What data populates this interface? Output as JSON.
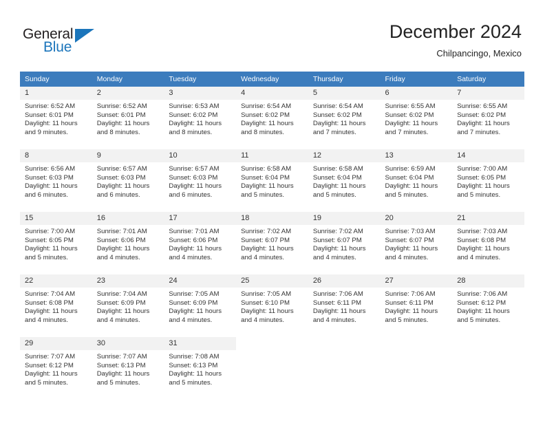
{
  "logo": {
    "word1": "General",
    "word2": "Blue",
    "triangle_icon": "triangle-icon",
    "color_blue": "#1b75bb",
    "color_dark": "#231f20"
  },
  "header": {
    "title": "December 2024",
    "subtitle": "Chilpancingo, Mexico"
  },
  "calendar": {
    "header_bg": "#3c7cbd",
    "daynum_bg": "#f2f2f2",
    "weekdays": [
      "Sunday",
      "Monday",
      "Tuesday",
      "Wednesday",
      "Thursday",
      "Friday",
      "Saturday"
    ],
    "weeks": [
      [
        {
          "day": "1",
          "sunrise": "Sunrise: 6:52 AM",
          "sunset": "Sunset: 6:01 PM",
          "daylight1": "Daylight: 11 hours",
          "daylight2": "and 9 minutes."
        },
        {
          "day": "2",
          "sunrise": "Sunrise: 6:52 AM",
          "sunset": "Sunset: 6:01 PM",
          "daylight1": "Daylight: 11 hours",
          "daylight2": "and 8 minutes."
        },
        {
          "day": "3",
          "sunrise": "Sunrise: 6:53 AM",
          "sunset": "Sunset: 6:02 PM",
          "daylight1": "Daylight: 11 hours",
          "daylight2": "and 8 minutes."
        },
        {
          "day": "4",
          "sunrise": "Sunrise: 6:54 AM",
          "sunset": "Sunset: 6:02 PM",
          "daylight1": "Daylight: 11 hours",
          "daylight2": "and 8 minutes."
        },
        {
          "day": "5",
          "sunrise": "Sunrise: 6:54 AM",
          "sunset": "Sunset: 6:02 PM",
          "daylight1": "Daylight: 11 hours",
          "daylight2": "and 7 minutes."
        },
        {
          "day": "6",
          "sunrise": "Sunrise: 6:55 AM",
          "sunset": "Sunset: 6:02 PM",
          "daylight1": "Daylight: 11 hours",
          "daylight2": "and 7 minutes."
        },
        {
          "day": "7",
          "sunrise": "Sunrise: 6:55 AM",
          "sunset": "Sunset: 6:02 PM",
          "daylight1": "Daylight: 11 hours",
          "daylight2": "and 7 minutes."
        }
      ],
      [
        {
          "day": "8",
          "sunrise": "Sunrise: 6:56 AM",
          "sunset": "Sunset: 6:03 PM",
          "daylight1": "Daylight: 11 hours",
          "daylight2": "and 6 minutes."
        },
        {
          "day": "9",
          "sunrise": "Sunrise: 6:57 AM",
          "sunset": "Sunset: 6:03 PM",
          "daylight1": "Daylight: 11 hours",
          "daylight2": "and 6 minutes."
        },
        {
          "day": "10",
          "sunrise": "Sunrise: 6:57 AM",
          "sunset": "Sunset: 6:03 PM",
          "daylight1": "Daylight: 11 hours",
          "daylight2": "and 6 minutes."
        },
        {
          "day": "11",
          "sunrise": "Sunrise: 6:58 AM",
          "sunset": "Sunset: 6:04 PM",
          "daylight1": "Daylight: 11 hours",
          "daylight2": "and 5 minutes."
        },
        {
          "day": "12",
          "sunrise": "Sunrise: 6:58 AM",
          "sunset": "Sunset: 6:04 PM",
          "daylight1": "Daylight: 11 hours",
          "daylight2": "and 5 minutes."
        },
        {
          "day": "13",
          "sunrise": "Sunrise: 6:59 AM",
          "sunset": "Sunset: 6:04 PM",
          "daylight1": "Daylight: 11 hours",
          "daylight2": "and 5 minutes."
        },
        {
          "day": "14",
          "sunrise": "Sunrise: 7:00 AM",
          "sunset": "Sunset: 6:05 PM",
          "daylight1": "Daylight: 11 hours",
          "daylight2": "and 5 minutes."
        }
      ],
      [
        {
          "day": "15",
          "sunrise": "Sunrise: 7:00 AM",
          "sunset": "Sunset: 6:05 PM",
          "daylight1": "Daylight: 11 hours",
          "daylight2": "and 5 minutes."
        },
        {
          "day": "16",
          "sunrise": "Sunrise: 7:01 AM",
          "sunset": "Sunset: 6:06 PM",
          "daylight1": "Daylight: 11 hours",
          "daylight2": "and 4 minutes."
        },
        {
          "day": "17",
          "sunrise": "Sunrise: 7:01 AM",
          "sunset": "Sunset: 6:06 PM",
          "daylight1": "Daylight: 11 hours",
          "daylight2": "and 4 minutes."
        },
        {
          "day": "18",
          "sunrise": "Sunrise: 7:02 AM",
          "sunset": "Sunset: 6:07 PM",
          "daylight1": "Daylight: 11 hours",
          "daylight2": "and 4 minutes."
        },
        {
          "day": "19",
          "sunrise": "Sunrise: 7:02 AM",
          "sunset": "Sunset: 6:07 PM",
          "daylight1": "Daylight: 11 hours",
          "daylight2": "and 4 minutes."
        },
        {
          "day": "20",
          "sunrise": "Sunrise: 7:03 AM",
          "sunset": "Sunset: 6:07 PM",
          "daylight1": "Daylight: 11 hours",
          "daylight2": "and 4 minutes."
        },
        {
          "day": "21",
          "sunrise": "Sunrise: 7:03 AM",
          "sunset": "Sunset: 6:08 PM",
          "daylight1": "Daylight: 11 hours",
          "daylight2": "and 4 minutes."
        }
      ],
      [
        {
          "day": "22",
          "sunrise": "Sunrise: 7:04 AM",
          "sunset": "Sunset: 6:08 PM",
          "daylight1": "Daylight: 11 hours",
          "daylight2": "and 4 minutes."
        },
        {
          "day": "23",
          "sunrise": "Sunrise: 7:04 AM",
          "sunset": "Sunset: 6:09 PM",
          "daylight1": "Daylight: 11 hours",
          "daylight2": "and 4 minutes."
        },
        {
          "day": "24",
          "sunrise": "Sunrise: 7:05 AM",
          "sunset": "Sunset: 6:09 PM",
          "daylight1": "Daylight: 11 hours",
          "daylight2": "and 4 minutes."
        },
        {
          "day": "25",
          "sunrise": "Sunrise: 7:05 AM",
          "sunset": "Sunset: 6:10 PM",
          "daylight1": "Daylight: 11 hours",
          "daylight2": "and 4 minutes."
        },
        {
          "day": "26",
          "sunrise": "Sunrise: 7:06 AM",
          "sunset": "Sunset: 6:11 PM",
          "daylight1": "Daylight: 11 hours",
          "daylight2": "and 4 minutes."
        },
        {
          "day": "27",
          "sunrise": "Sunrise: 7:06 AM",
          "sunset": "Sunset: 6:11 PM",
          "daylight1": "Daylight: 11 hours",
          "daylight2": "and 5 minutes."
        },
        {
          "day": "28",
          "sunrise": "Sunrise: 7:06 AM",
          "sunset": "Sunset: 6:12 PM",
          "daylight1": "Daylight: 11 hours",
          "daylight2": "and 5 minutes."
        }
      ],
      [
        {
          "day": "29",
          "sunrise": "Sunrise: 7:07 AM",
          "sunset": "Sunset: 6:12 PM",
          "daylight1": "Daylight: 11 hours",
          "daylight2": "and 5 minutes."
        },
        {
          "day": "30",
          "sunrise": "Sunrise: 7:07 AM",
          "sunset": "Sunset: 6:13 PM",
          "daylight1": "Daylight: 11 hours",
          "daylight2": "and 5 minutes."
        },
        {
          "day": "31",
          "sunrise": "Sunrise: 7:08 AM",
          "sunset": "Sunset: 6:13 PM",
          "daylight1": "Daylight: 11 hours",
          "daylight2": "and 5 minutes."
        },
        {
          "day": "",
          "sunrise": "",
          "sunset": "",
          "daylight1": "",
          "daylight2": ""
        },
        {
          "day": "",
          "sunrise": "",
          "sunset": "",
          "daylight1": "",
          "daylight2": ""
        },
        {
          "day": "",
          "sunrise": "",
          "sunset": "",
          "daylight1": "",
          "daylight2": ""
        },
        {
          "day": "",
          "sunrise": "",
          "sunset": "",
          "daylight1": "",
          "daylight2": ""
        }
      ]
    ]
  }
}
